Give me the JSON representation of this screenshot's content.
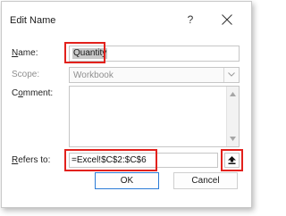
{
  "dialog": {
    "title": "Edit Name",
    "help_glyph": "?",
    "close_icon": "close-icon"
  },
  "fields": {
    "name_label_mnemonic": "N",
    "name_label_rest": "ame:",
    "name_value": "Quantity",
    "scope_label": "Scope:",
    "scope_value": "Workbook",
    "comment_label_pre": "C",
    "comment_label_mnemonic": "o",
    "comment_label_rest": "mment:",
    "comment_value": "",
    "refers_label_mnemonic": "R",
    "refers_label_rest": "efers to:",
    "refers_value": "=Excel!$C$2:$C$6"
  },
  "buttons": {
    "ok_label": "OK",
    "cancel_label": "Cancel"
  },
  "colors": {
    "highlight": "#e2211c",
    "default_button_border": "#2b7bd6",
    "selection": "#c8c8c8"
  }
}
